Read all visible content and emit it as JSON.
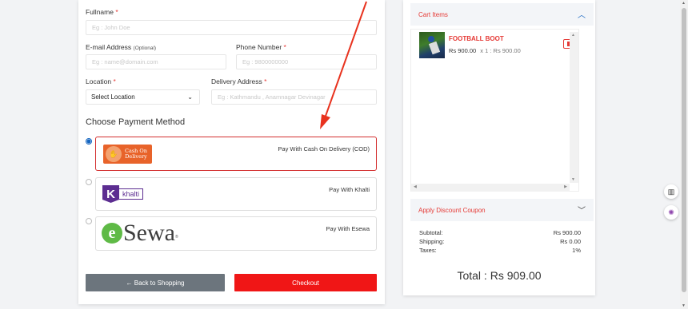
{
  "form": {
    "fullname_label": "Fullname",
    "fullname_placeholder": "Eg : John Doe",
    "email_label": "E-mail Address",
    "email_optional": "(Optional)",
    "email_placeholder": "Eg : name@domain.com",
    "phone_label": "Phone Number",
    "phone_placeholder": "Eg : 9800000000",
    "location_label": "Location",
    "location_value": "Select Location",
    "address_label": "Delivery Address",
    "address_placeholder": "Eg : Kathmandu , Anamnagar Devinagar",
    "required_mark": "*"
  },
  "payment": {
    "title": "Choose Payment Method",
    "options": [
      {
        "label": "Pay With Cash On Delivery (COD)",
        "logo_line1": "Cash On",
        "logo_line2": "Delivery",
        "selected": true
      },
      {
        "label": "Pay With Khalti",
        "logo_word": "khalti",
        "logo_mark": "K",
        "selected": false
      },
      {
        "label": "Pay With Esewa",
        "logo_mark": "e",
        "logo_word": "Sewa",
        "logo_reg": "®",
        "selected": false
      }
    ]
  },
  "buttons": {
    "back_label": "← Back to Shopping",
    "checkout_label": "Checkout"
  },
  "cart": {
    "header": "Cart Items",
    "items": [
      {
        "name": "FOOTBALL BOOT",
        "price": "Rs 900.00",
        "qty_line": "x 1 : Rs 900.00"
      }
    ],
    "coupon_header": "Apply Discount Coupon",
    "subtotal_label": "Subtotal:",
    "subtotal_value": "Rs 900.00",
    "shipping_label": "Shipping:",
    "shipping_value": "Rs 0.00",
    "taxes_label": "Taxes:",
    "taxes_value": "1%",
    "total_label": "Total : Rs 909.00"
  },
  "colors": {
    "accent_red": "#f01616",
    "selected_blue": "#1565c0",
    "khalti_purple": "#5c2d91",
    "esewa_green": "#5fba46",
    "cod_orange": "#e8632a"
  },
  "icons": [
    "chevron-up-icon",
    "chevron-down-icon",
    "trash-icon",
    "arrow-left-icon",
    "book-icon",
    "brain-icon"
  ]
}
